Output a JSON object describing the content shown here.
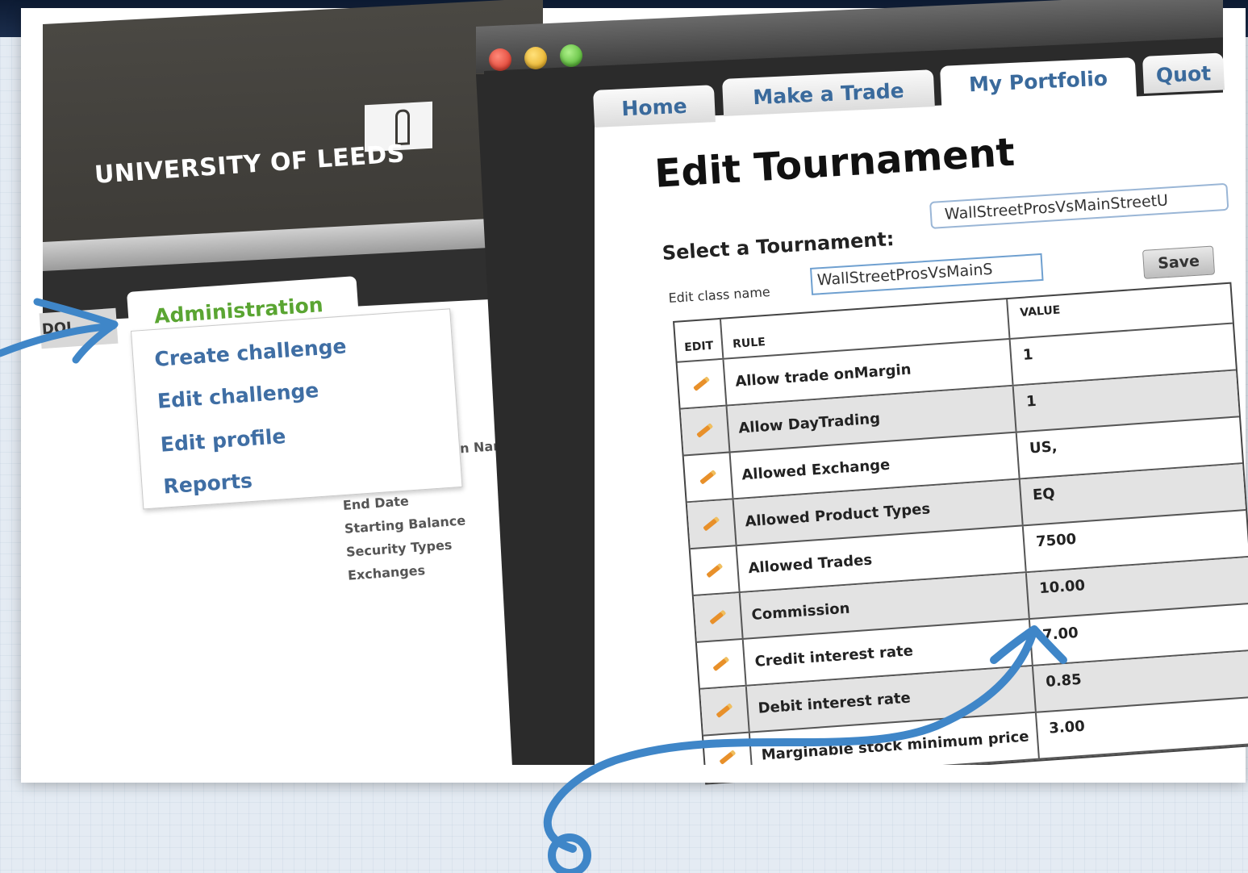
{
  "back_window": {
    "university_name": "UNIVERSITY OF LEEDS",
    "left_tab_label": "DOL",
    "admin_tab_label": "Administration",
    "menu_items": [
      "Create challenge",
      "Edit challenge",
      "Edit profile",
      "Reports"
    ],
    "background_partial_label": "n Name",
    "background_fields": [
      "End Date",
      "Starting Balance",
      "Security Types",
      "Exchanges"
    ]
  },
  "front_window": {
    "tabs": [
      {
        "label": "Home",
        "active": false
      },
      {
        "label": "Make a Trade",
        "active": false
      },
      {
        "label": "My Portfolio",
        "active": true
      },
      {
        "label": "Quot",
        "active": false
      }
    ],
    "heading": "Edit Tournament",
    "select_label": "Select a Tournament:",
    "select_value": "WallStreetProsVsMainStreetU",
    "class_name_label": "Edit class name",
    "class_name_value": "WallStreetProsVsMainS",
    "save_label": "Save",
    "table": {
      "headers": {
        "edit": "EDIT",
        "rule": "RULE",
        "value": "VALUE"
      },
      "rows": [
        {
          "rule": "Allow trade onMargin",
          "value": "1"
        },
        {
          "rule": "Allow DayTrading",
          "value": "1"
        },
        {
          "rule": "Allowed Exchange",
          "value": "US,"
        },
        {
          "rule": "Allowed Product Types",
          "value": "EQ"
        },
        {
          "rule": "Allowed Trades",
          "value": "7500"
        },
        {
          "rule": "Commission",
          "value": "10.00"
        },
        {
          "rule": "Credit interest rate",
          "value": "7.00"
        },
        {
          "rule": "Debit interest rate",
          "value": "0.85"
        },
        {
          "rule": "Marginable stock minimum price",
          "value": "3.00"
        }
      ]
    }
  },
  "colors": {
    "leeds_header": "#3c3a36",
    "admin_green": "#5aa532",
    "link_blue": "#3f6ea4",
    "annotation_blue": "#3f86c8",
    "edit_pencil": "#e8902a"
  },
  "icons": {
    "edit_row": "pencil-icon",
    "window_controls": [
      "close-icon",
      "minimize-icon",
      "zoom-icon"
    ]
  }
}
